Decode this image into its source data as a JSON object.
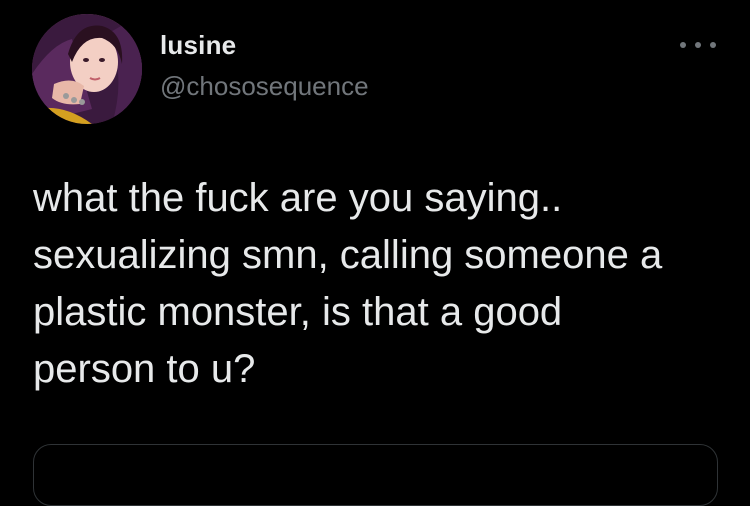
{
  "user": {
    "display_name": "lusine",
    "handle": "@chososequence"
  },
  "menu": {
    "icon": "more-horizontal-icon"
  },
  "tweet": {
    "text": "what the fuck are you saying..\nsexualizing smn, calling someone a\nplastic monster, is that a good\nperson to u?"
  },
  "colors": {
    "background": "#000000",
    "primary_text": "#e7e9ea",
    "secondary_text": "#71767b",
    "border": "#2f3336"
  }
}
